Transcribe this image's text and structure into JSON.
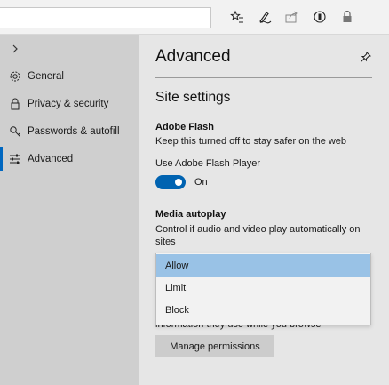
{
  "toolbar": {
    "address_value": "",
    "icons": [
      "favorites-star-icon",
      "pen-icon",
      "share-icon",
      "reader-mode-icon",
      "extension-icon"
    ]
  },
  "sidebar": {
    "items": [
      {
        "label": "General",
        "icon": "gear-icon"
      },
      {
        "label": "Privacy & security",
        "icon": "lock-icon"
      },
      {
        "label": "Passwords & autofill",
        "icon": "key-icon"
      },
      {
        "label": "Advanced",
        "icon": "sliders-icon",
        "active": true
      }
    ]
  },
  "panel": {
    "title": "Advanced",
    "section_title": "Site settings",
    "flash": {
      "heading": "Adobe Flash",
      "description": "Keep this turned off to stay safer on the web",
      "toggle_label": "Use Adobe Flash Player",
      "toggle_state": "On",
      "toggle_on": true
    },
    "autoplay": {
      "heading": "Media autoplay",
      "description_line1": "Control if audio and video play automatically on",
      "description_line2": "sites",
      "options": [
        "Allow",
        "Limit",
        "Block"
      ],
      "selected": "Allow"
    },
    "partial_text": "information they use while you browse",
    "manage_button": "Manage permissions"
  },
  "colors": {
    "accent": "#0063b1",
    "selected_option": "#99c2e6",
    "sidebar_bg": "#cfcfcf",
    "panel_bg": "#e6e6e6"
  }
}
